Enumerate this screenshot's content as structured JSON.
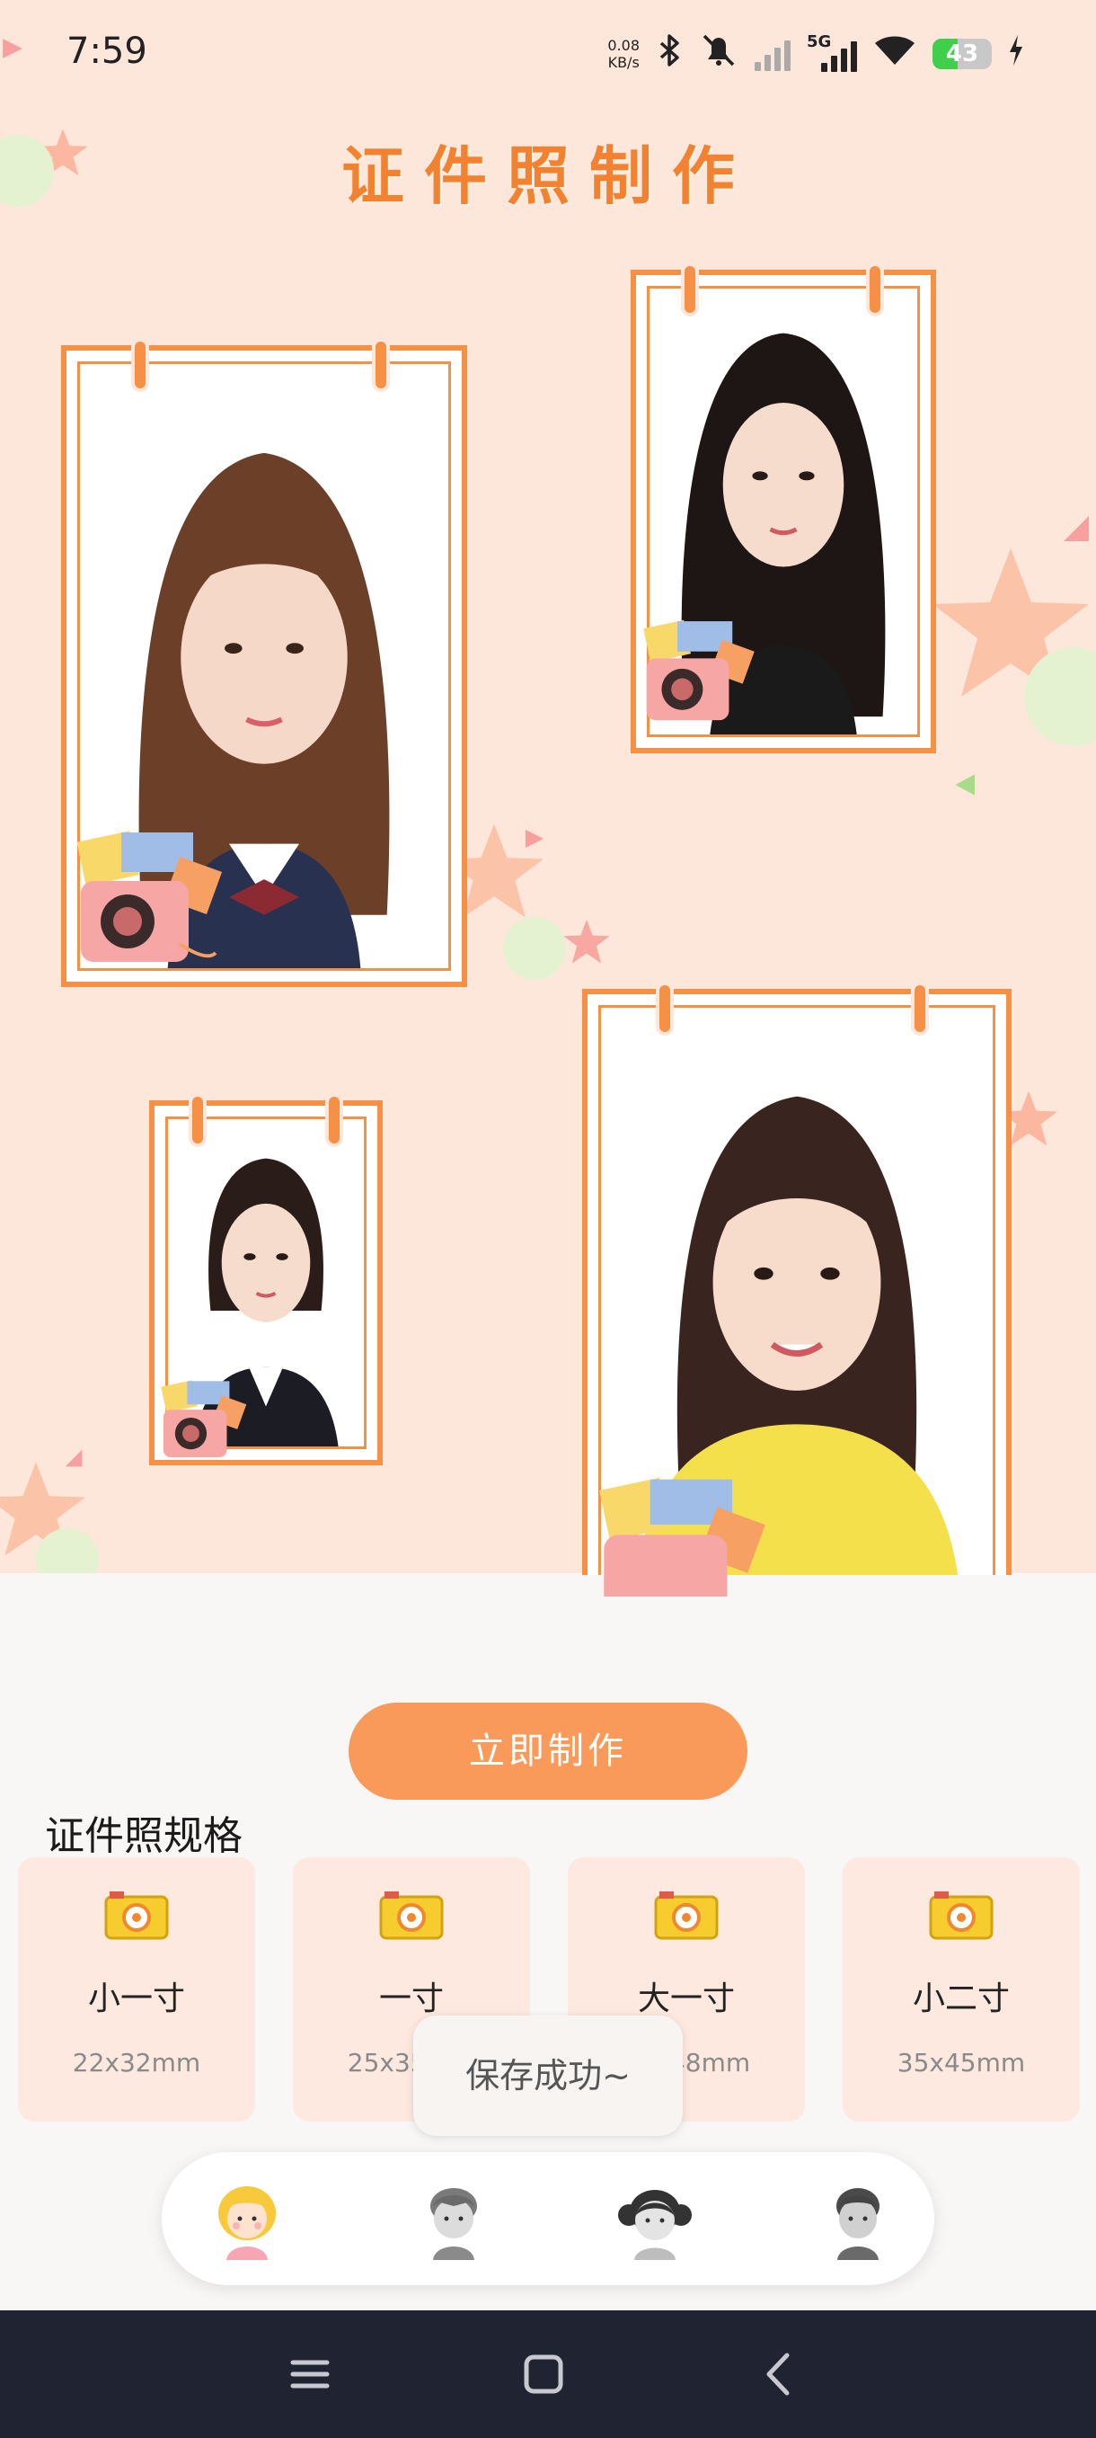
{
  "status_bar": {
    "time": "7:59",
    "net_speed_value": "0.08",
    "net_speed_unit": "KB/s",
    "network": "5G",
    "battery": "43",
    "battery_level": 0.43
  },
  "header": {
    "title": "证件照制作"
  },
  "actions": {
    "create_label": "立即制作"
  },
  "specs": {
    "title": "证件照规格",
    "items": [
      {
        "name": "小一寸",
        "size": "22x32mm"
      },
      {
        "name": "一寸",
        "size": "25x35mm"
      },
      {
        "name": "大一寸",
        "size": "33x48mm"
      },
      {
        "name": "小二寸",
        "size": "35x45mm"
      }
    ]
  },
  "toast": {
    "message": "保存成功~"
  },
  "tabbar": {
    "items": [
      {
        "icon": "girl-avatar-icon",
        "active": true
      },
      {
        "icon": "boy-avatar-icon",
        "active": false
      },
      {
        "icon": "pigtails-girl-avatar-icon",
        "active": false
      },
      {
        "icon": "man-avatar-icon",
        "active": false
      }
    ]
  },
  "nav": {
    "icons": [
      "menu-icon",
      "home-icon",
      "back-icon"
    ]
  },
  "colors": {
    "accent": "#f59045",
    "hero_bg": "#fde6da",
    "button": "#f99a5b",
    "card_bg": "#fde9df"
  }
}
